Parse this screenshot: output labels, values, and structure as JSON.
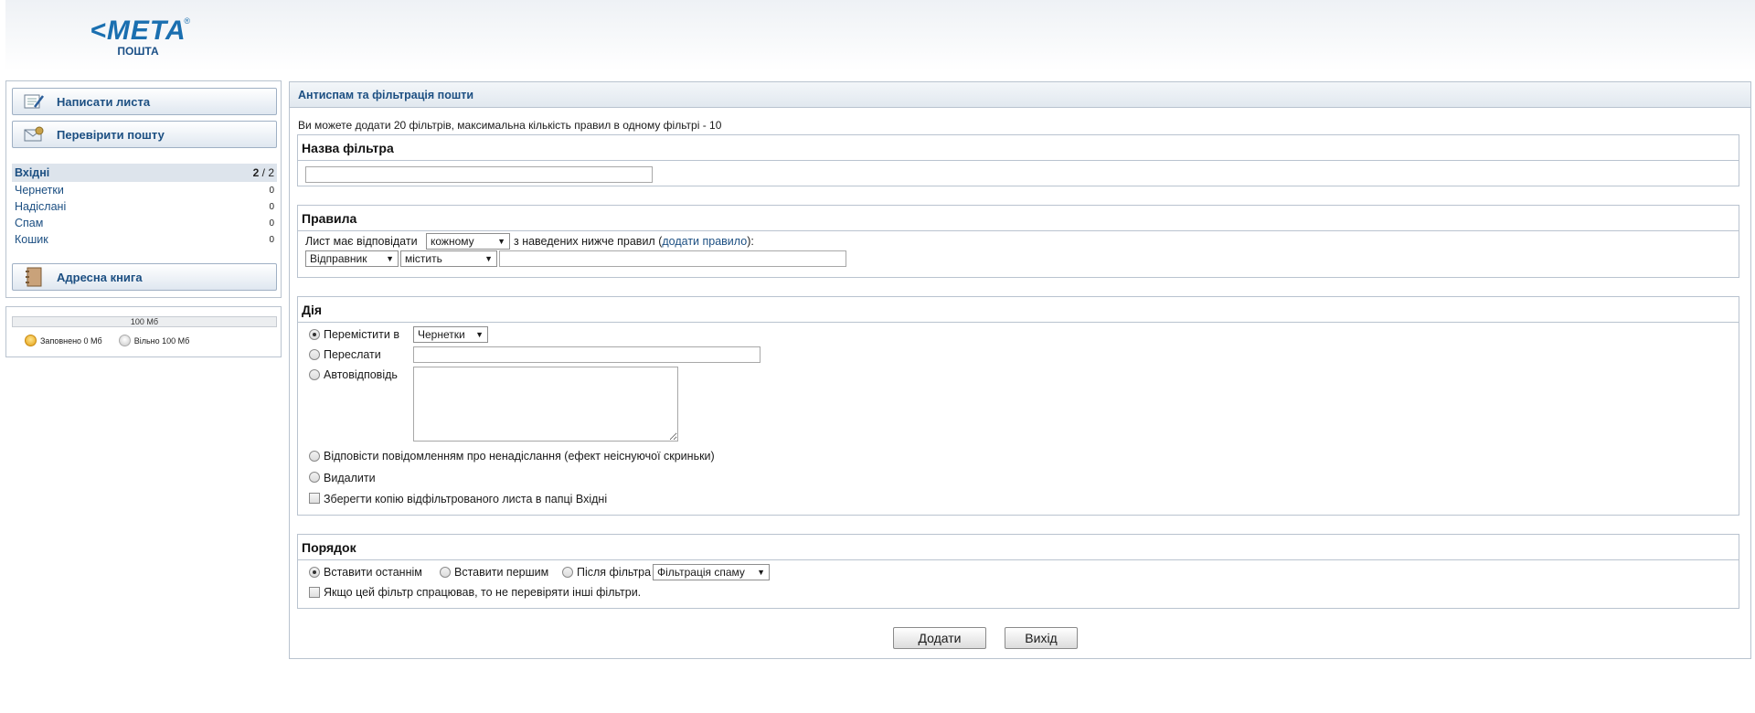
{
  "logo": {
    "word": "<META",
    "sub": "ПОШТА",
    "reg": "®"
  },
  "sidebar": {
    "compose_label": "Написати листа",
    "check_label": "Перевірити пошту",
    "address_book_label": "Адресна книга",
    "folders": [
      {
        "name": "Вхідні",
        "unread": "2",
        "total": "/ 2"
      },
      {
        "name": "Чернетки",
        "count": "0"
      },
      {
        "name": "Надіслані",
        "count": "0"
      },
      {
        "name": "Спам",
        "count": "0"
      },
      {
        "name": "Кошик",
        "count": "0"
      }
    ]
  },
  "quota": {
    "total": "100 Мб",
    "used_fraction": 0,
    "used_label": "Заповнено 0 Мб",
    "free_label": "Вільно 100 Мб"
  },
  "main": {
    "title": "Антиспам та фільтрація пошти",
    "info": "Ви можете додати 20 фільтрів, максимальна кількість правил в одному фільтрі - 10",
    "name_section": {
      "title": "Назва фільтра",
      "value": ""
    },
    "rules_section": {
      "title": "Правила",
      "prefix": "Лист має відповідати",
      "match_select": "кожному",
      "suffix": "з наведених нижче правил (",
      "add_rule_link": "додати правило",
      "suffix_end": "):",
      "field_select": "Відправник",
      "cond_select": "містить",
      "value": ""
    },
    "action_section": {
      "title": "Дія",
      "move_label": "Перемістити в",
      "move_select": "Чернетки",
      "forward_label": "Переслати",
      "autoreply_label": "Автовідповідь",
      "bounce_label": "Відповісти повідомленням про ненадіслання (ефект неіснуючої скриньки)",
      "delete_label": "Видалити",
      "keep_copy_label": "Зберегти копію відфільтрованого листа в папці Вхідні"
    },
    "order_section": {
      "title": "Порядок",
      "insert_last": "Вставити останнім",
      "insert_first": "Вставити першим",
      "after_filter": "Після фільтра",
      "after_select": "Фільтрація спаму",
      "stop_label": "Якщо цей фільтр спрацював, то не перевіряти інші фільтри."
    },
    "add_button": "Додати",
    "exit_button": "Вихід"
  }
}
